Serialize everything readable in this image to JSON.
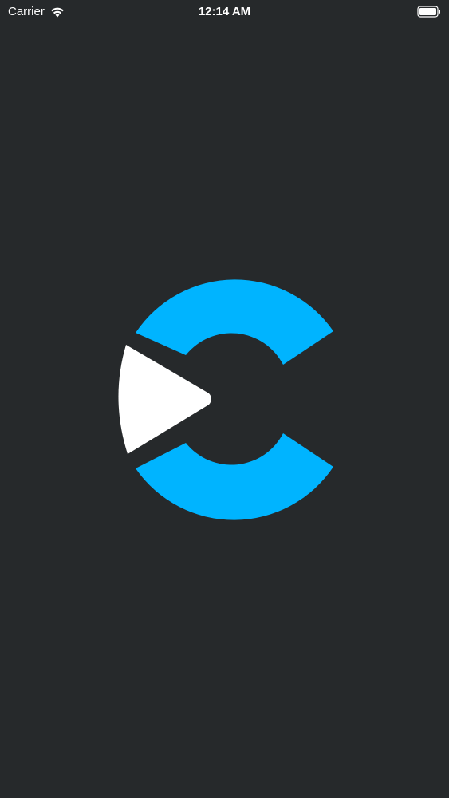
{
  "status_bar": {
    "carrier": "Carrier",
    "time": "12:14 AM",
    "wifi_icon": "wifi-icon",
    "battery_icon": "battery-icon"
  },
  "splash": {
    "logo_icon": "play-c-logo-icon",
    "colors": {
      "background": "#26292b",
      "logo_accent": "#00b4ff",
      "play_triangle": "#ffffff"
    }
  }
}
